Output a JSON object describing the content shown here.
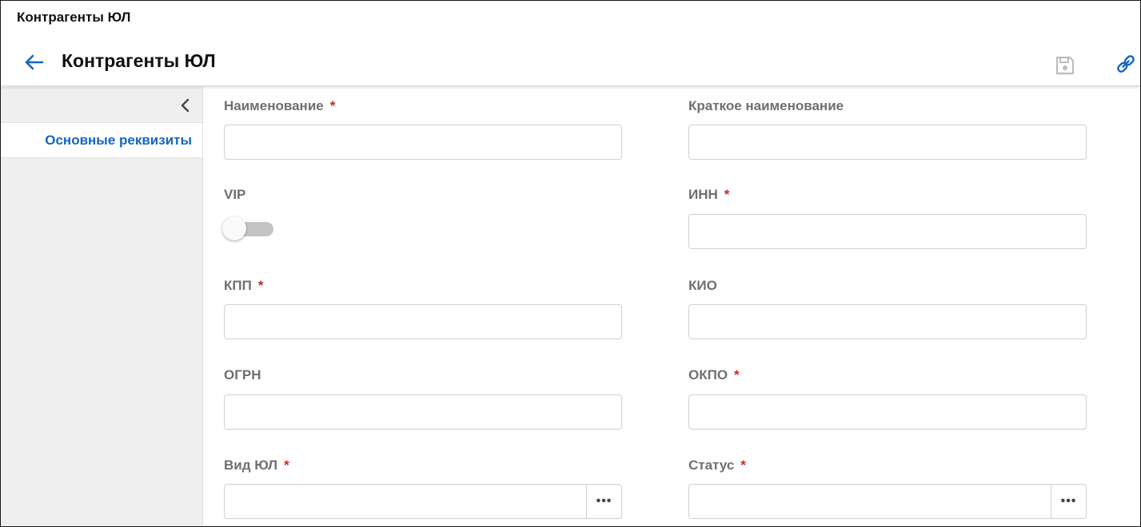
{
  "window": {
    "title": "Контрагенты ЮЛ"
  },
  "header": {
    "title": "Контрагенты ЮЛ",
    "back_icon": "arrow-left-icon",
    "save_icon": "floppy-disk-icon",
    "link_icon": "link-icon",
    "accent_color": "#1565c0"
  },
  "sidebar": {
    "collapse_icon": "chevron-left-icon",
    "items": [
      {
        "label": "Основные реквизиты",
        "active": true
      }
    ]
  },
  "form": {
    "naimenovanie": {
      "label": "Наименование",
      "required": "*",
      "value": ""
    },
    "kratkoe": {
      "label": "Краткое наименование",
      "value": ""
    },
    "vip": {
      "label": "VIP",
      "checked": false
    },
    "inn": {
      "label": "ИНН",
      "required": "*",
      "value": ""
    },
    "kpp": {
      "label": "КПП",
      "required": "*",
      "value": ""
    },
    "kio": {
      "label": "КИО",
      "value": ""
    },
    "ogrn": {
      "label": "ОГРН",
      "value": ""
    },
    "okpo": {
      "label": "ОКПО",
      "required": "*",
      "value": ""
    },
    "vid_yul": {
      "label": "Вид ЮЛ",
      "required": "*",
      "value": "",
      "button": "•••"
    },
    "status": {
      "label": "Статус",
      "required": "*",
      "value": "",
      "button": "•••"
    }
  }
}
